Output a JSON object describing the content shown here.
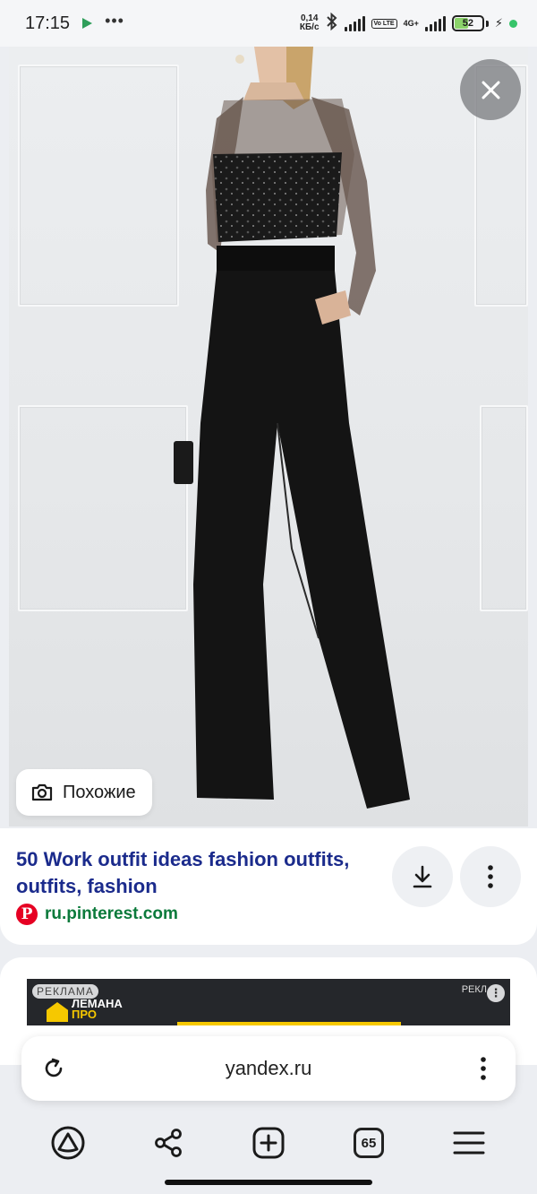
{
  "status_bar": {
    "time": "17:15",
    "net_speed_value": "0,14",
    "net_speed_unit": "КБ/с",
    "volte": "Vo LTE",
    "network": "4G+",
    "battery": "52"
  },
  "viewer": {
    "similar_label": "Похожие"
  },
  "result": {
    "title": "50 Work outfit ideas fashion outfits, outfits, fashion",
    "source": "ru.pinterest.com"
  },
  "ad": {
    "badge": "РЕКЛАМА",
    "badge_right": "РЕКЛ",
    "brand_line1": "ЛЕМАНА",
    "brand_line2": "ПРО"
  },
  "browser": {
    "url": "yandex.ru",
    "tabs_count": "65"
  },
  "colors": {
    "title_blue": "#1b2b8c",
    "source_green": "#0b7a3b",
    "pinterest_red": "#e60023",
    "ad_yellow": "#f6c800"
  }
}
